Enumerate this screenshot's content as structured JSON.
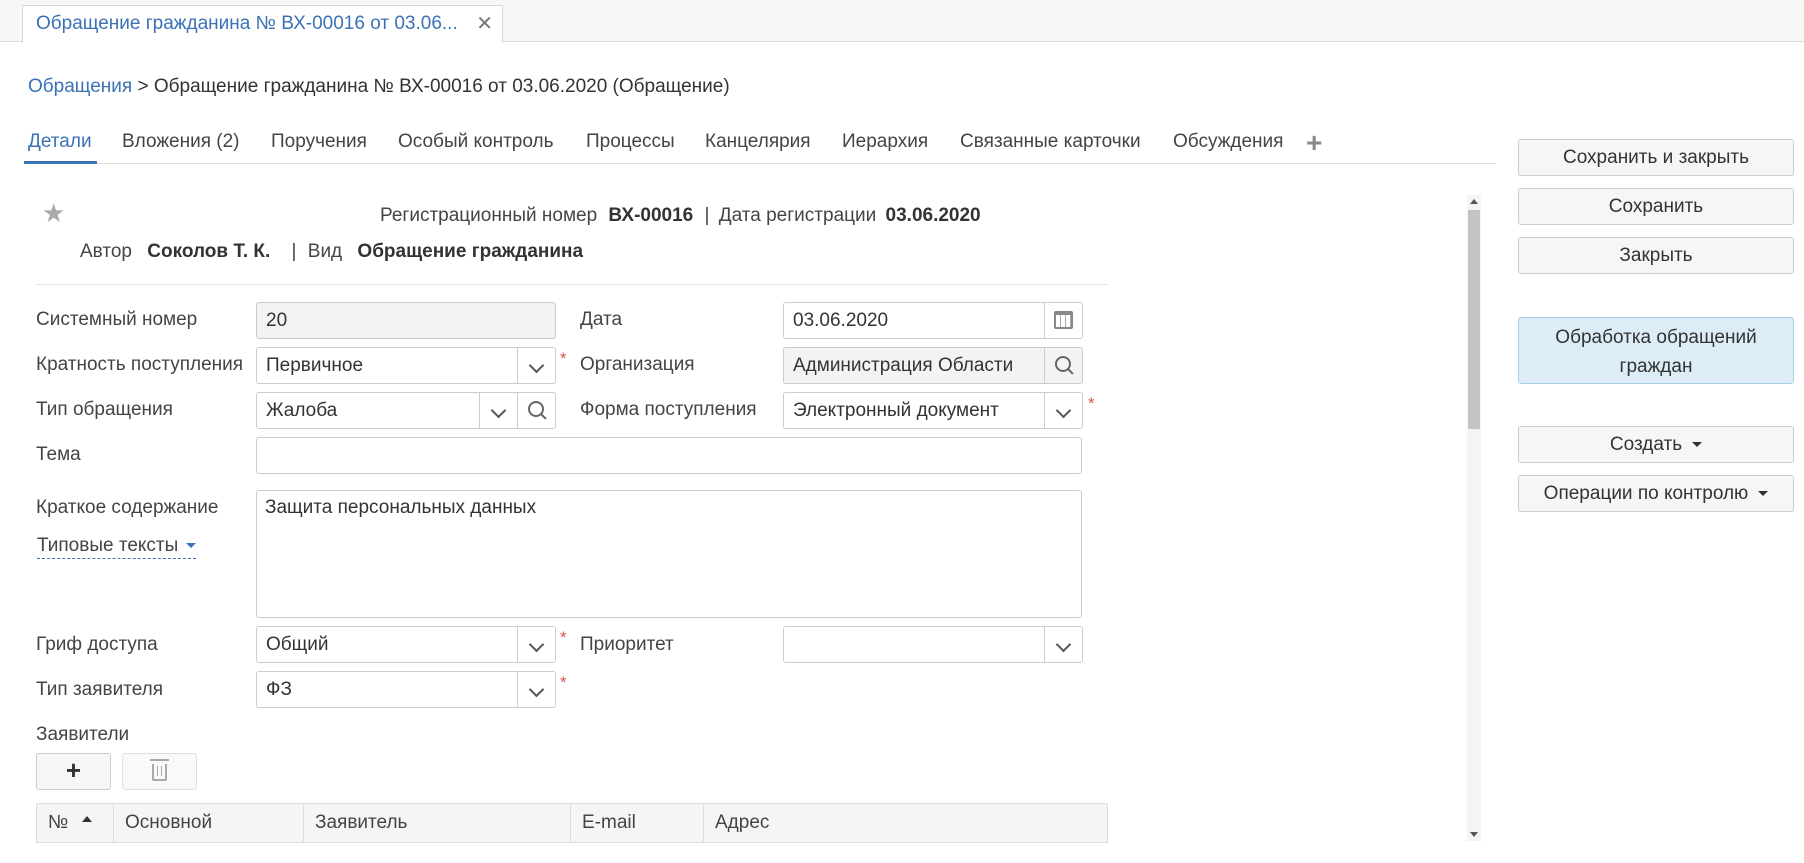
{
  "window_tab": {
    "title": "Обращение гражданина № ВХ-00016 от 03.06...",
    "close": "✕"
  },
  "breadcrumb": {
    "root": "Обращения",
    "current": " > Обращение гражданина № ВХ-00016 от 03.06.2020 (Обращение)"
  },
  "tabs": [
    {
      "label": "Детали"
    },
    {
      "label": "Вложения (2)"
    },
    {
      "label": "Поручения"
    },
    {
      "label": "Особый контроль"
    },
    {
      "label": "Процессы"
    },
    {
      "label": "Канцелярия"
    },
    {
      "label": "Иерархия"
    },
    {
      "label": "Связанные карточки"
    },
    {
      "label": "Обсуждения"
    }
  ],
  "tabs_add": "+",
  "header": {
    "reg_number_label": "Регистрационный номер",
    "reg_number": "ВХ-00016",
    "sep1": "|",
    "reg_date_label": "Дата регистрации",
    "reg_date": "03.06.2020",
    "author_label": "Автор",
    "author": "Соколов Т. К.",
    "sep2": "|",
    "kind_label": "Вид",
    "kind": "Обращение гражданина"
  },
  "form": {
    "system_number_label": "Системный номер",
    "system_number": "20",
    "date_label": "Дата",
    "date": "03.06.2020",
    "multiplicity_label": "Кратность поступления",
    "multiplicity": "Первичное",
    "organization_label": "Организация",
    "organization": "Администрация Области",
    "appeal_type_label": "Тип обращения",
    "appeal_type": "Жалоба",
    "receipt_form_label": "Форма поступления",
    "receipt_form": "Электронный документ",
    "topic_label": "Тема",
    "topic": "",
    "summary_label": "Краткое содержание",
    "summary": "Защита персональных данных",
    "template_texts": "Типовые тексты",
    "access_label": "Гриф доступа",
    "access": "Общий",
    "priority_label": "Приоритет",
    "priority": "",
    "applicant_type_label": "Тип заявителя",
    "applicant_type": "ФЗ",
    "applicants_label": "Заявители",
    "required_mark": "*"
  },
  "applicants_table": {
    "columns": [
      "№",
      "Основной",
      "Заявитель",
      "E-mail",
      "Адрес"
    ]
  },
  "actions": {
    "save_close": "Сохранить и закрыть",
    "save": "Сохранить",
    "close": "Закрыть",
    "process": "Обработка обращений граждан",
    "create": "Создать",
    "control_ops": "Операции по контролю"
  },
  "colors": {
    "accent": "#3a72b5",
    "required": "#d9534f",
    "highlight_button": "#dcedf7"
  }
}
